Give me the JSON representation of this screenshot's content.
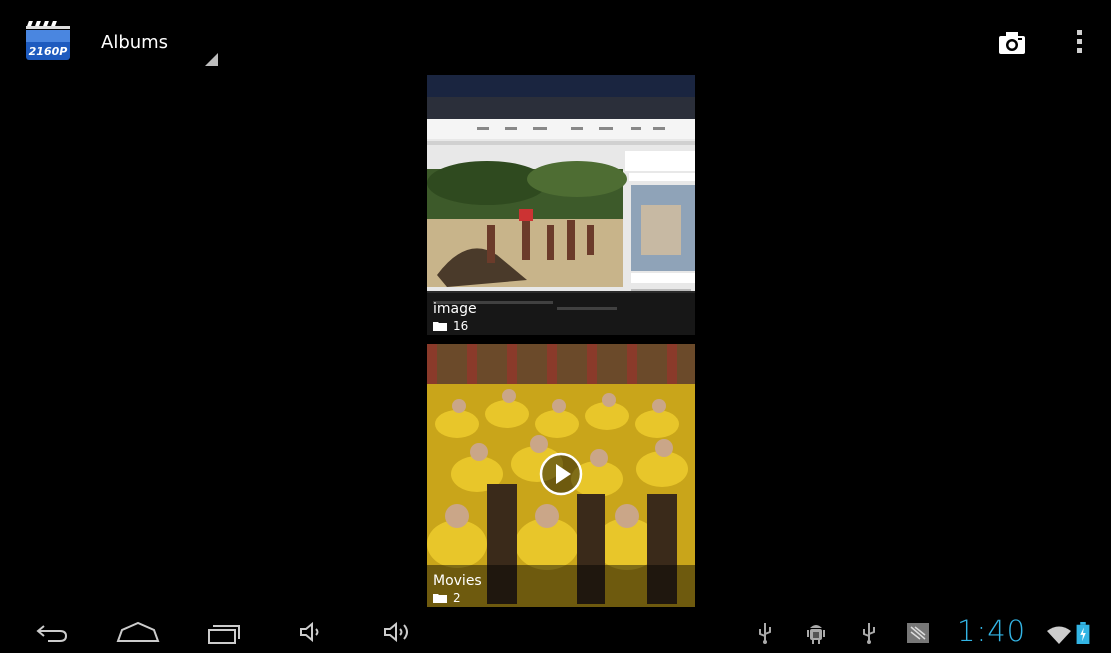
{
  "app": {
    "logo_text": "2160P",
    "title": "Albums"
  },
  "actions": {
    "camera_icon": "camera-icon",
    "overflow_icon": "overflow-menu-icon"
  },
  "albums": [
    {
      "name": "image",
      "count": "16",
      "thumbnail": "web-page-screenshot"
    },
    {
      "name": "Movies",
      "count": "2",
      "thumbnail": "video-monks",
      "is_video": true
    }
  ],
  "navbar": {
    "buttons": [
      "back-icon",
      "home-icon",
      "recent-apps-icon",
      "volume-down-icon",
      "volume-up-icon"
    ]
  },
  "status": {
    "icons": [
      "usb-icon",
      "android-debug-icon",
      "usb-icon",
      "notification-icon"
    ],
    "time": "1:40",
    "wifi": "wifi-icon",
    "battery": "battery-charging-icon",
    "accent_color": "#33b5e5"
  }
}
